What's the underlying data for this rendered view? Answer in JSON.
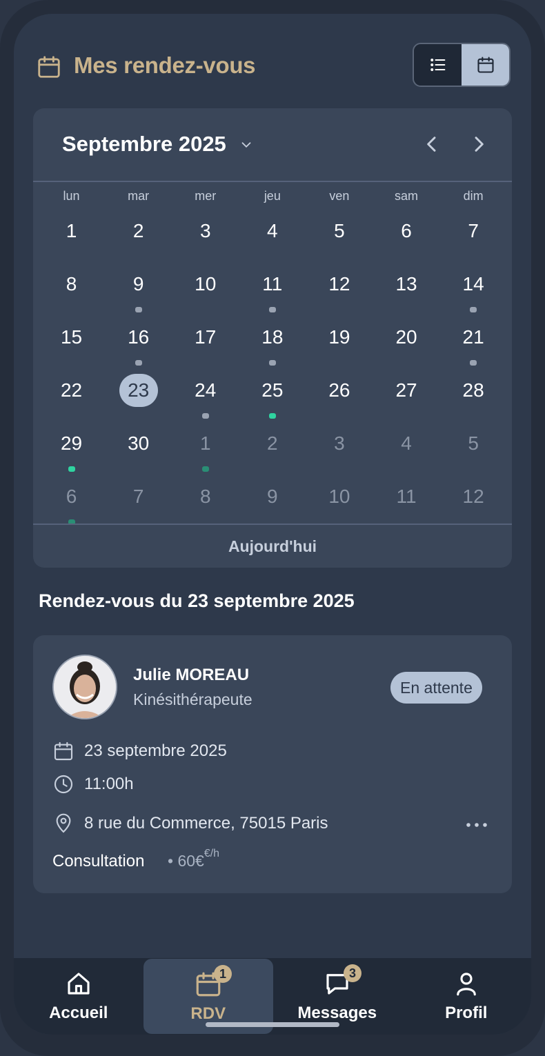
{
  "header": {
    "title": "Mes rendez-vous"
  },
  "calendar": {
    "month_label": "Septembre 2025",
    "weekdays": [
      "lun",
      "mar",
      "mer",
      "jeu",
      "ven",
      "sam",
      "dim"
    ],
    "weeks": [
      [
        {
          "n": "1"
        },
        {
          "n": "2"
        },
        {
          "n": "3"
        },
        {
          "n": "4"
        },
        {
          "n": "5"
        },
        {
          "n": "6"
        },
        {
          "n": "7"
        }
      ],
      [
        {
          "n": "8"
        },
        {
          "n": "9",
          "dot": "gray"
        },
        {
          "n": "10"
        },
        {
          "n": "11",
          "dot": "gray"
        },
        {
          "n": "12"
        },
        {
          "n": "13"
        },
        {
          "n": "14",
          "dot": "gray"
        }
      ],
      [
        {
          "n": "15"
        },
        {
          "n": "16",
          "dot": "gray"
        },
        {
          "n": "17"
        },
        {
          "n": "18",
          "dot": "gray"
        },
        {
          "n": "19"
        },
        {
          "n": "20"
        },
        {
          "n": "21",
          "dot": "gray"
        }
      ],
      [
        {
          "n": "22"
        },
        {
          "n": "23",
          "selected": true
        },
        {
          "n": "24",
          "dot": "gray"
        },
        {
          "n": "25",
          "dot": "green"
        },
        {
          "n": "26"
        },
        {
          "n": "27"
        },
        {
          "n": "28"
        }
      ],
      [
        {
          "n": "29",
          "dot": "green"
        },
        {
          "n": "30"
        },
        {
          "n": "1",
          "muted": true,
          "dot": "green-dim"
        },
        {
          "n": "2",
          "muted": true
        },
        {
          "n": "3",
          "muted": true
        },
        {
          "n": "4",
          "muted": true
        },
        {
          "n": "5",
          "muted": true
        }
      ],
      [
        {
          "n": "6",
          "muted": true,
          "dot": "green-dim"
        },
        {
          "n": "7",
          "muted": true
        },
        {
          "n": "8",
          "muted": true
        },
        {
          "n": "9",
          "muted": true
        },
        {
          "n": "10",
          "muted": true
        },
        {
          "n": "11",
          "muted": true
        },
        {
          "n": "12",
          "muted": true
        }
      ]
    ],
    "today_label": "Aujourd'hui"
  },
  "day_section": {
    "title": "Rendez-vous du 23 septembre 2025"
  },
  "appointment": {
    "name": "Julie MOREAU",
    "role": "Kinésithérapeute",
    "status": "En attente",
    "date": "23 septembre 2025",
    "time": "11:00h",
    "address": "8 rue du Commerce, 75015 Paris",
    "type": "Consultation",
    "price": "• 60€",
    "price_unit": "€/h"
  },
  "nav": {
    "items": [
      {
        "label": "Accueil"
      },
      {
        "label": "RDV",
        "badge": "1"
      },
      {
        "label": "Messages",
        "badge": "3"
      },
      {
        "label": "Profil"
      }
    ]
  },
  "colors": {
    "accent": "#c9b38c",
    "selected": "#b4c2d6",
    "dot_green": "#2fd3a0",
    "dot_gray": "#9aa3b2"
  }
}
